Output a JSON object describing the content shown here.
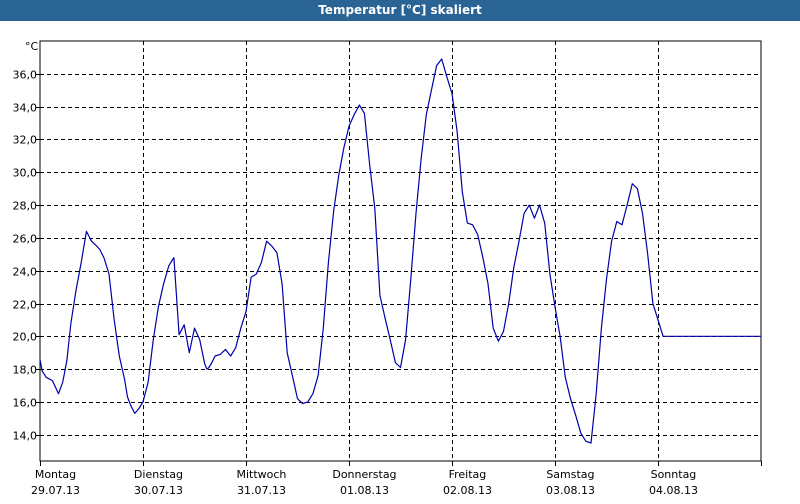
{
  "window": {
    "title": "Temperatur [°C] skaliert"
  },
  "chart_data": {
    "type": "line",
    "title": "Temperatur [°C] skaliert",
    "ylabel": "°C",
    "xlabel": "",
    "ylim": [
      12.4,
      38.0
    ],
    "xlim": [
      0,
      7
    ],
    "yticks": [
      14,
      16,
      18,
      20,
      22,
      24,
      26,
      28,
      30,
      32,
      34,
      36
    ],
    "ytick_labels": [
      "14,0",
      "16,0",
      "18,0",
      "20,0",
      "22,0",
      "24,0",
      "26,0",
      "28,0",
      "30,0",
      "32,0",
      "34,0",
      "36,0"
    ],
    "grid": true,
    "line_color": "#0000aa",
    "days": [
      {
        "weekday": "Montag",
        "date": "29.07.13"
      },
      {
        "weekday": "Dienstag",
        "date": "30.07.13"
      },
      {
        "weekday": "Mittwoch",
        "date": "31.07.13"
      },
      {
        "weekday": "Donnerstag",
        "date": "01.08.13"
      },
      {
        "weekday": "Freitag",
        "date": "02.08.13"
      },
      {
        "weekday": "Samstag",
        "date": "03.08.13"
      },
      {
        "weekday": "Sonntag",
        "date": "04.08.13"
      }
    ],
    "series": [
      {
        "x": [
          0.0,
          0.02,
          0.06,
          0.12,
          0.18,
          0.22,
          0.26,
          0.3,
          0.35,
          0.4,
          0.45,
          0.5,
          0.55,
          0.58,
          0.62,
          0.67,
          0.72,
          0.77,
          0.82,
          0.85,
          0.88,
          0.92,
          0.96,
          1.0,
          1.05,
          1.1,
          1.15,
          1.2,
          1.25,
          1.3,
          1.35,
          1.4,
          1.45,
          1.5,
          1.55,
          1.6,
          1.62,
          1.64,
          1.66,
          1.7,
          1.75,
          1.8,
          1.85,
          1.9,
          1.95,
          2.0,
          2.05,
          2.1,
          2.15,
          2.2,
          2.25,
          2.3,
          2.35,
          2.4,
          2.45,
          2.5,
          2.55,
          2.6,
          2.65,
          2.7,
          2.75,
          2.8,
          2.85,
          2.9,
          2.95,
          3.0,
          3.05,
          3.1,
          3.15,
          3.2,
          3.25,
          3.3,
          3.35,
          3.4,
          3.45,
          3.5,
          3.55,
          3.6,
          3.65,
          3.7,
          3.75,
          3.8,
          3.85,
          3.9,
          3.95,
          4.0,
          4.05,
          4.1,
          4.15,
          4.2,
          4.25,
          4.3,
          4.35,
          4.4,
          4.45,
          4.5,
          4.55,
          4.6,
          4.65,
          4.7,
          4.75,
          4.8,
          4.85,
          4.9,
          4.95,
          5.0,
          5.05,
          5.1,
          5.15,
          5.2,
          5.25,
          5.3,
          5.35,
          5.4,
          5.45,
          5.5,
          5.55,
          5.6,
          5.65,
          5.7,
          5.75,
          5.8,
          5.85,
          5.9,
          5.95,
          6.0,
          6.05,
          6.1,
          6.15,
          6.2,
          6.25,
          6.3,
          6.35,
          6.4,
          6.45,
          6.5,
          6.55,
          6.6,
          6.65,
          6.7,
          6.75,
          6.8,
          6.85,
          6.9,
          6.95,
          7.0
        ],
        "y": [
          18.6,
          17.9,
          17.5,
          17.3,
          16.5,
          17.2,
          18.5,
          20.8,
          22.8,
          24.5,
          26.4,
          25.8,
          25.5,
          25.3,
          24.8,
          23.8,
          21.0,
          18.8,
          17.4,
          16.3,
          15.8,
          15.3,
          15.6,
          16.0,
          17.2,
          19.8,
          21.8,
          23.2,
          24.3,
          24.8,
          20.1,
          20.7,
          19.0,
          20.5,
          19.8,
          18.3,
          18.0,
          18.1,
          18.3,
          18.8,
          18.9,
          19.2,
          18.8,
          19.3,
          20.5,
          21.5,
          23.6,
          23.8,
          24.5,
          25.8,
          25.5,
          25.1,
          23.2,
          19.0,
          17.6,
          16.2,
          15.9,
          16.0,
          16.5,
          17.6,
          20.5,
          24.5,
          27.6,
          29.8,
          31.5,
          32.8,
          33.5,
          34.1,
          33.6,
          30.5,
          27.8,
          22.5,
          21.1,
          19.8,
          18.4,
          18.1,
          19.8,
          23.5,
          27.5,
          30.8,
          33.5,
          35.0,
          36.5,
          36.9,
          35.8,
          34.8,
          32.5,
          28.8,
          26.9,
          26.8,
          26.2,
          24.8,
          23.2,
          20.5,
          19.7,
          20.3,
          22.0,
          24.2,
          25.8,
          27.5,
          28.0,
          27.2,
          28.0,
          26.9,
          23.8,
          21.8,
          20.0,
          17.5,
          16.2,
          15.2,
          14.1,
          13.6,
          13.5,
          16.5,
          20.5,
          23.5,
          25.8,
          27.0,
          26.8,
          28.0,
          29.3,
          29.0,
          27.5,
          25.0,
          22.0,
          21.0,
          20.0,
          20.0,
          20.0,
          20.0,
          20.0,
          20.0,
          20.0,
          20.0,
          20.0,
          20.0,
          20.0,
          20.0,
          20.0,
          20.0,
          20.0,
          20.0,
          20.0,
          20.0,
          20.0,
          20.0
        ]
      }
    ]
  }
}
